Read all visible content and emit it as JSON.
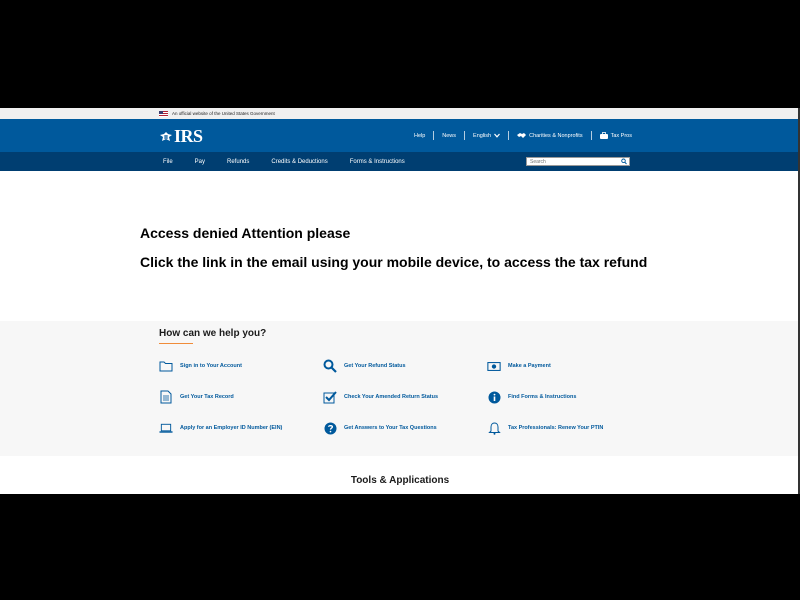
{
  "gov_banner": {
    "text": "An official website of the United States Government"
  },
  "header": {
    "logo_text": "IRS",
    "utility": {
      "help": "Help",
      "news": "News",
      "language": "English",
      "charities": "Charities & Nonprofits",
      "tax_pros": "Tax Pros"
    }
  },
  "nav": {
    "items": [
      "File",
      "Pay",
      "Refunds",
      "Credits & Deductions",
      "Forms & Instructions"
    ],
    "search_placeholder": "Search"
  },
  "alert": {
    "line1": "Access denied Attention please",
    "line2": "Click the link in the email using your mobile device, to access the tax refund"
  },
  "help": {
    "title": "How can we help you?",
    "items": [
      {
        "label": "Sign in to Your Account",
        "icon": "folder-icon"
      },
      {
        "label": "Get Your Refund Status",
        "icon": "search-icon"
      },
      {
        "label": "Make a Payment",
        "icon": "money-icon"
      },
      {
        "label": "Get Your Tax Record",
        "icon": "document-icon"
      },
      {
        "label": "Check Your Amended Return Status",
        "icon": "checkbox-icon"
      },
      {
        "label": "Find Forms & Instructions",
        "icon": "info-icon"
      },
      {
        "label": "Apply for an Employer ID Number (EIN)",
        "icon": "laptop-icon"
      },
      {
        "label": "Get Answers to Your Tax Questions",
        "icon": "question-icon"
      },
      {
        "label": "Tax Professionals: Renew Your PTIN",
        "icon": "bell-icon"
      }
    ]
  },
  "tools": {
    "title": "Tools & Applications"
  },
  "colors": {
    "header_blue": "#00599c",
    "nav_blue": "#003e71",
    "accent_orange": "#f08c3a"
  }
}
